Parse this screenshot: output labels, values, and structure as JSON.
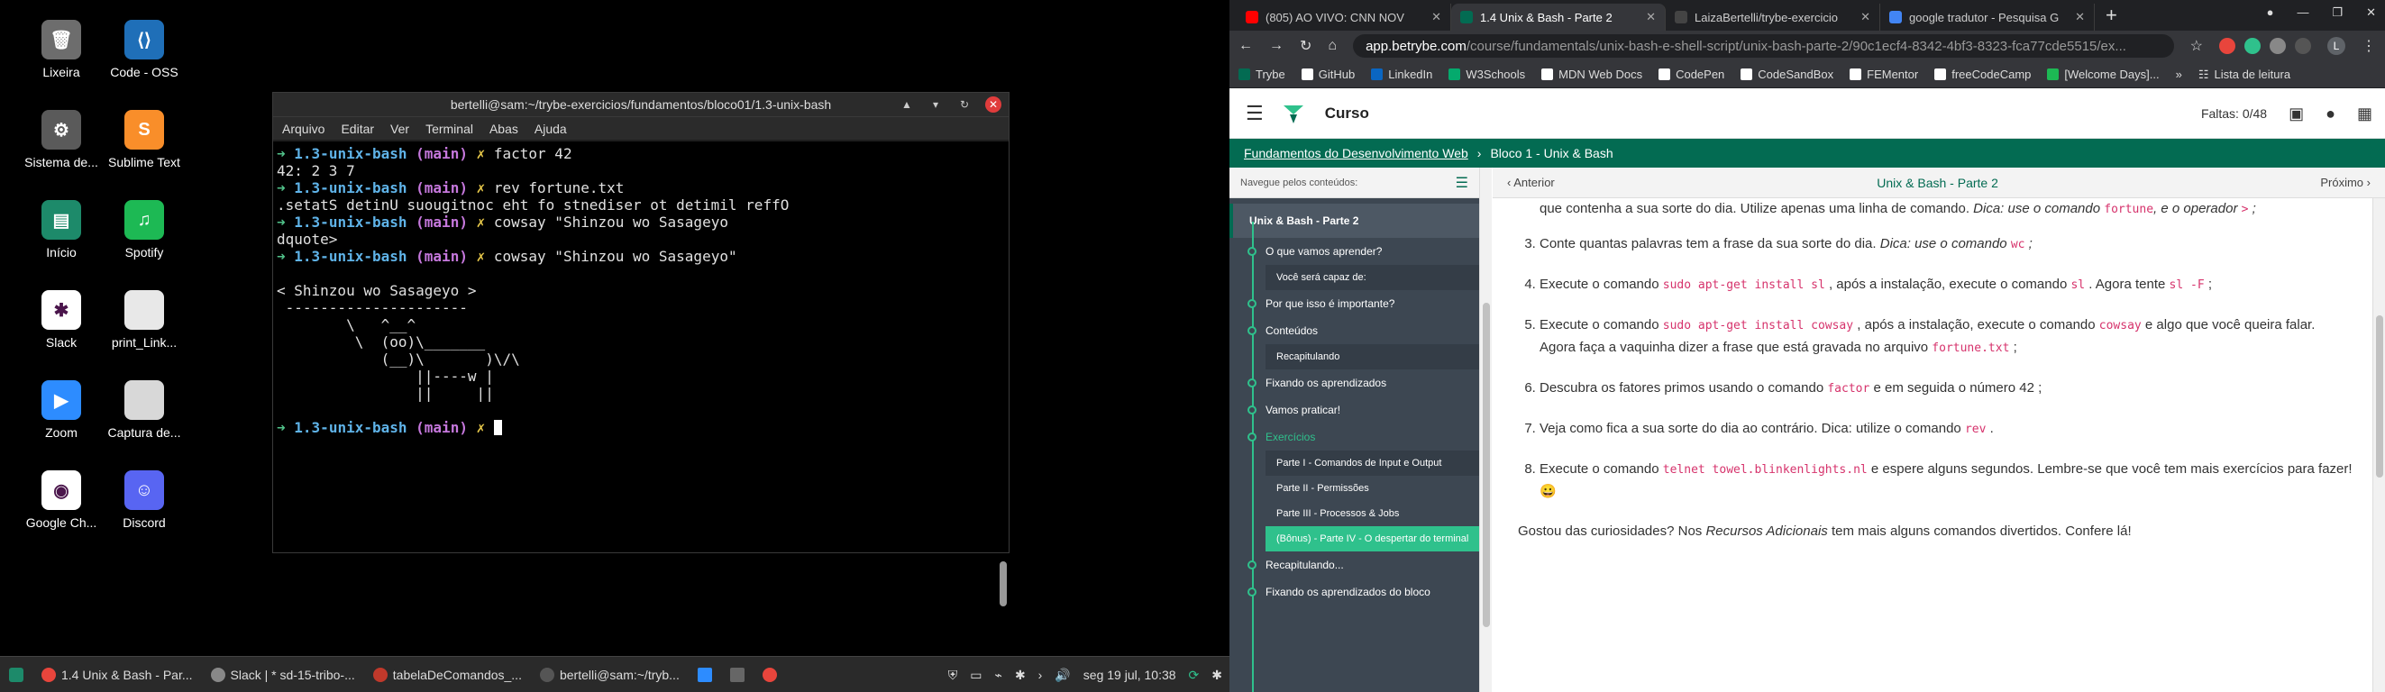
{
  "desktop": {
    "icons": [
      {
        "label": "Lixeira",
        "color": "#6d6d6d",
        "glyph": "🗑"
      },
      {
        "label": "Code - OSS",
        "color": "#1f6fb8",
        "glyph": "⟨⟩"
      },
      {
        "label": "Sistema de...",
        "color": "#5a5a5a",
        "glyph": "⚙"
      },
      {
        "label": "Sublime Text",
        "color": "#f98e2a",
        "glyph": "S"
      },
      {
        "label": "Início",
        "color": "#1d8a6a",
        "glyph": "▤"
      },
      {
        "label": "Spotify",
        "color": "#1db954",
        "glyph": "♫"
      },
      {
        "label": "Slack",
        "color": "#ffffff",
        "glyph": "✱"
      },
      {
        "label": "print_Link...",
        "color": "#e8e8e8",
        "glyph": ""
      },
      {
        "label": "Zoom",
        "color": "#2d8cff",
        "glyph": "▶"
      },
      {
        "label": "Captura de...",
        "color": "#d8d8d8",
        "glyph": ""
      },
      {
        "label": "Google Ch...",
        "color": "#ffffff",
        "glyph": "◉"
      },
      {
        "label": "Discord",
        "color": "#5865f2",
        "glyph": "☺"
      }
    ]
  },
  "terminal": {
    "title": "bertelli@sam:~/trybe-exercicios/fundamentos/bloco01/1.3-unix-bash",
    "controls": [
      "▲",
      "▾",
      "↻"
    ],
    "close": "✕",
    "menu": [
      "Arquivo",
      "Editar",
      "Ver",
      "Terminal",
      "Abas",
      "Ajuda"
    ],
    "prompt": {
      "arrow": "➜",
      "dir": "1.3-unix-bash",
      "branch": "(main)",
      "mark": "✗"
    },
    "cmd1": "factor 42",
    "out1": "42: 2 3 7",
    "cmd2": "rev fortune.txt",
    "out2": ".setatS detinU suougitnoc eht fo stnediser ot detimil reffO",
    "cmd3": "cowsay \"Shinzou wo Sasageyo",
    "out3": "dquote>",
    "cmd4": "cowsay \"Shinzou wo Sasageyo\"",
    "cow": "< Shinzou wo Sasageyo >\n ---------------------\n        \\   ^__^\n         \\  (oo)\\_______\n            (__)\\       )\\/\\\n                ||----w |\n                ||     ||"
  },
  "taskbar": {
    "tasks": [
      {
        "label": "1.4 Unix & Bash - Par...",
        "color": "#e8453c"
      },
      {
        "label": "Slack | * sd-15-tribo-...",
        "color": "#888888"
      },
      {
        "label": "tabelaDeComandos_...",
        "color": "#c0392b"
      },
      {
        "label": "bertelli@sam:~/tryb...",
        "color": "#555555"
      }
    ],
    "clock": "seg 19 jul, 10:38"
  },
  "browser": {
    "tabs": [
      {
        "label": "(805) AO VIVO: CNN NOV",
        "color": "#ff0000"
      },
      {
        "label": "1.4 Unix & Bash - Parte 2",
        "color": "#036b52"
      },
      {
        "label": "LaizaBertelli/trybe-exercicio",
        "color": "#444444"
      },
      {
        "label": "google tradutor - Pesquisa G",
        "color": "#4285f4"
      }
    ],
    "close_glyph": "✕",
    "newtab": "+",
    "window_controls": [
      "●",
      "—",
      "❐",
      "✕"
    ],
    "nav": {
      "back": "←",
      "forward": "→",
      "reload": "↻",
      "home": "⌂"
    },
    "url_host": "app.betrybe.com",
    "url_path": "/course/fundamentals/unix-bash-e-shell-script/unix-bash-parte-2/90c1ecf4-8342-4bf3-8323-fca77cde5515/ex...",
    "star": "☆",
    "profile": "L",
    "menu_dots": "⋮",
    "bookmarks": [
      {
        "label": "Trybe",
        "color": "#036b52"
      },
      {
        "label": "GitHub",
        "color": "#ffffff"
      },
      {
        "label": "LinkedIn",
        "color": "#0a66c2"
      },
      {
        "label": "W3Schools",
        "color": "#04aa6d"
      },
      {
        "label": "MDN Web Docs",
        "color": "#ffffff"
      },
      {
        "label": "CodePen",
        "color": "#ffffff"
      },
      {
        "label": "CodeSandBox",
        "color": "#ffffff"
      },
      {
        "label": "FEMentor",
        "color": "#ffffff"
      },
      {
        "label": "freeCodeCamp",
        "color": "#ffffff"
      },
      {
        "label": "[Welcome Days]...",
        "color": "#1db954"
      }
    ],
    "more_bookmarks": "»",
    "reading_list": "Lista de leitura"
  },
  "site": {
    "hamburger": "☰",
    "curso": "Curso",
    "faltas": "Faltas: 0/48",
    "crumb_root": "Fundamentos do Desenvolvimento Web",
    "crumb_sep": "›",
    "crumb_current": "Bloco 1 - Unix & Bash",
    "sidebar_head": "Navegue pelos conteúdos:",
    "sidebar_toggle": "☰",
    "sidebar_top": "Unix & Bash - Parte 2",
    "sidebar": [
      {
        "label": "O que vamos aprender?",
        "kind": "item"
      },
      {
        "label": "Você será capaz de:",
        "kind": "sub"
      },
      {
        "label": "Por que isso é importante?",
        "kind": "item"
      },
      {
        "label": "Conteúdos",
        "kind": "item"
      },
      {
        "label": "Recapitulando",
        "kind": "sub"
      },
      {
        "label": "Fixando os aprendizados",
        "kind": "item"
      },
      {
        "label": "Vamos praticar!",
        "kind": "item"
      },
      {
        "label": "Exercícios",
        "kind": "green"
      },
      {
        "label": "Parte I - Comandos de Input e Output",
        "kind": "sub"
      },
      {
        "label": "Parte II - Permissões",
        "kind": "plain"
      },
      {
        "label": "Parte III - Processos & Jobs",
        "kind": "plain"
      },
      {
        "label": "(Bônus) - Parte IV - O despertar do terminal",
        "kind": "active"
      },
      {
        "label": "Recapitulando...",
        "kind": "item"
      },
      {
        "label": "Fixando os aprendizados do bloco",
        "kind": "item"
      }
    ],
    "prev": "Anterior",
    "page_title": "Unix & Bash - Parte 2",
    "next": "Próximo",
    "item2_a": "que contenha a sua sorte do dia. Utilize apenas uma linha de comando.",
    "item2_em": "Dica: use o comando",
    "item2_code1": "fortune",
    "item2_em2": ", e o operador",
    "item2_code2": ">",
    "item2_end": ";",
    "item3_a": "Conte quantas palavras tem a frase da sua sorte do dia.",
    "item3_em": "Dica: use o comando",
    "item3_code": "wc",
    "item3_end": ";",
    "item4_a": "Execute o comando",
    "item4_code1": "sudo apt-get install sl",
    "item4_b": ", após a instalação, execute o comando",
    "item4_code2": "sl",
    "item4_c": ". Agora tente",
    "item4_code3": "sl -F",
    "item4_end": ";",
    "item5_a": "Execute o comando",
    "item5_code1": "sudo apt-get install cowsay",
    "item5_b": ", após a instalação, execute o comando",
    "item5_code2": "cowsay",
    "item5_c": "e algo que você queira falar. Agora faça a vaquinha dizer a frase que está gravada no arquivo",
    "item5_code3": "fortune.txt",
    "item5_end": ";",
    "item6_a": "Descubra os fatores primos usando o comando",
    "item6_code": "factor",
    "item6_b": "e em seguida o número 42 ;",
    "item7_a": "Veja como fica a sua sorte do dia ao contrário. Dica: utilize o comando",
    "item7_code": "rev",
    "item7_end": ".",
    "item8_a": "Execute o comando",
    "item8_code": "telnet towel.blinkenlights.nl",
    "item8_b": "e espere alguns segundos. Lembre-se que você tem mais exercícios para fazer! 😀",
    "outro_a": "Gostou das curiosidades? Nos",
    "outro_em": "Recursos Adicionais",
    "outro_b": "tem mais alguns comandos divertidos. Confere lá!"
  }
}
